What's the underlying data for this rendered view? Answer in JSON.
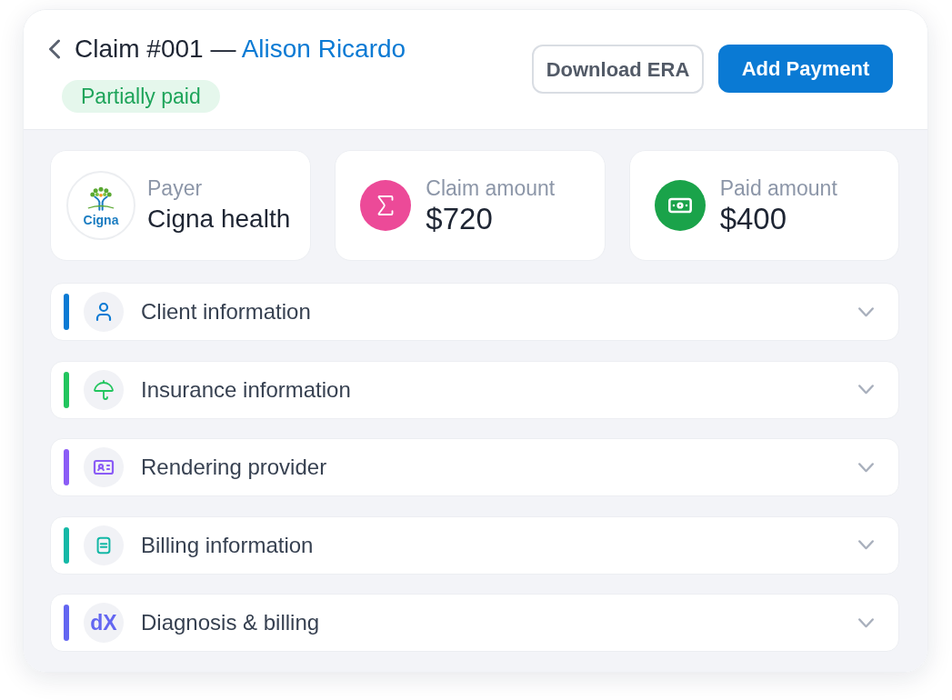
{
  "header": {
    "title": "Claim #001 —",
    "client_name": "Alison Ricardo",
    "status": "Partially paid",
    "buttons": [
      {
        "label": "Download ERA",
        "kind": "secondary"
      },
      {
        "label": "Add Payment",
        "kind": "primary"
      }
    ]
  },
  "stats": [
    {
      "kind": "payer",
      "label": "Payer",
      "value": "Cigna health",
      "logo_text": "Cigna"
    },
    {
      "kind": "amount",
      "label": "Claim amount",
      "value": "$720",
      "color": "#ec4a98"
    },
    {
      "kind": "amount",
      "label": "Paid amount",
      "value": "$400",
      "color": "#1aa34a"
    }
  ],
  "sections": [
    {
      "label": "Client information",
      "color": "#0a7ad4",
      "expanded": false
    },
    {
      "label": "Insurance information",
      "color": "#22c55e",
      "expanded": false
    },
    {
      "label": "Rendering provider",
      "color": "#8b5cf6",
      "expanded": false
    },
    {
      "label": "Billing information",
      "color": "#14b8a6",
      "expanded": false
    },
    {
      "label": "Diagnosis & billing",
      "color": "#6366f1",
      "expanded": false,
      "badge_text": "dX"
    }
  ]
}
